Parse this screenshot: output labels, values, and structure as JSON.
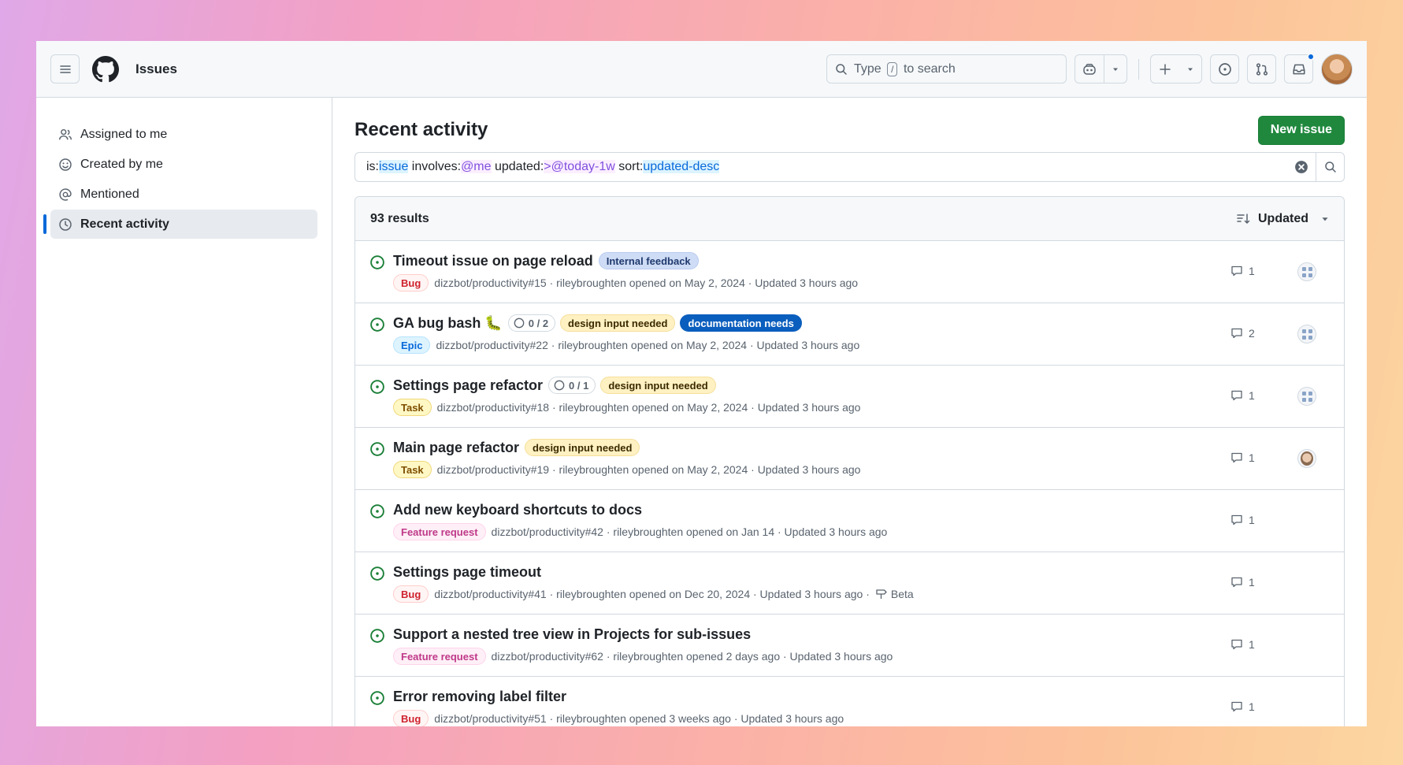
{
  "header": {
    "app_title": "Issues",
    "search_prefix": "Type",
    "search_key": "/",
    "search_suffix": "to search"
  },
  "sidebar": {
    "items": [
      {
        "label": "Assigned to me",
        "icon": "people-icon"
      },
      {
        "label": "Created by me",
        "icon": "smiley-icon"
      },
      {
        "label": "Mentioned",
        "icon": "mention-icon"
      },
      {
        "label": "Recent activity",
        "icon": "clock-icon",
        "active": true
      }
    ]
  },
  "main": {
    "title": "Recent activity",
    "new_issue_label": "New issue",
    "query": {
      "k1": "is:",
      "v1": "issue",
      "k2": " involves:",
      "v2": "@me",
      "k3": " updated:",
      "v3": ">@today-1w",
      "k4": " sort:",
      "v4": "updated-desc"
    },
    "results_count": "93 results",
    "sort_label": "Updated"
  },
  "issues": [
    {
      "title": "Timeout issue on page reload",
      "type": "Bug",
      "meta": "dizzbot/productivity#15 · rileybroughten opened on May 2, 2024 · Updated 3 hours ago",
      "comments": "1",
      "labels": [
        "Internal feedback"
      ]
    },
    {
      "title": "GA bug bash 🐛",
      "type": "Epic",
      "meta": "dizzbot/productivity#22 · rileybroughten opened on May 2, 2024 · Updated 3 hours ago",
      "comments": "2",
      "progress": "0 / 2",
      "labels": [
        "design input needed",
        "documentation needs"
      ]
    },
    {
      "title": "Settings page refactor",
      "type": "Task",
      "meta": "dizzbot/productivity#18 · rileybroughten opened on May 2, 2024 · Updated 3 hours ago",
      "comments": "1",
      "progress": "0 / 1",
      "labels": [
        "design input needed"
      ]
    },
    {
      "title": "Main page refactor",
      "type": "Task",
      "meta": "dizzbot/productivity#19 · rileybroughten opened on May 2, 2024 · Updated 3 hours ago",
      "comments": "1",
      "labels": [
        "design input needed"
      ]
    },
    {
      "title": "Add new keyboard shortcuts to docs",
      "type": "Feature request",
      "meta": "dizzbot/productivity#42 · rileybroughten opened on Jan 14 · Updated 3 hours ago",
      "comments": "1"
    },
    {
      "title": "Settings page timeout",
      "type": "Bug",
      "meta": "dizzbot/productivity#41 · rileybroughten opened on Dec 20, 2024 · Updated 3 hours ago ·",
      "milestone": "Beta",
      "comments": "1"
    },
    {
      "title": "Support a nested tree view in Projects for sub-issues",
      "type": "Feature request",
      "meta": "dizzbot/productivity#62 · rileybroughten opened 2 days ago · Updated 3 hours ago",
      "comments": "1"
    },
    {
      "title": "Error removing label filter",
      "type": "Bug",
      "meta": "dizzbot/productivity#51 · rileybroughten opened 3 weeks ago · Updated 3 hours ago",
      "comments": "1"
    }
  ],
  "colors": {
    "accent": "#0969da",
    "primary_button": "#1f883d",
    "open_state": "#1a7f37"
  }
}
